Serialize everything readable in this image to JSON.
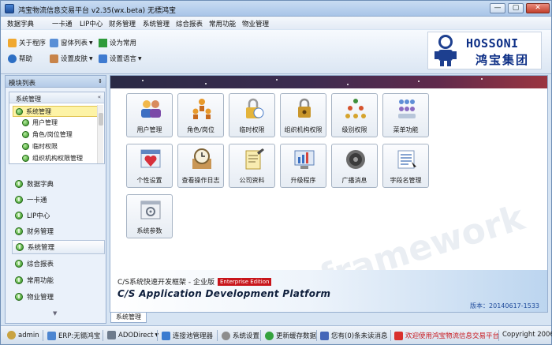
{
  "window": {
    "title": "鸿宝物流信息交易平台 v2.35(wx.beta) 无標鸿宝",
    "min": "—",
    "max": "▢",
    "close": "✕"
  },
  "menu": [
    "数据字典",
    "一卡通",
    "LIP中心",
    "财务管理",
    "系统管理",
    "综合报表",
    "常用功能",
    "物业管理"
  ],
  "toolbar": {
    "about": "关于程序",
    "window_list": "窗体列表",
    "set_common": "设为常用",
    "help": "帮助",
    "skin": "设置皮肤",
    "language": "设置语言"
  },
  "logo": {
    "en": "HOSSONI",
    "cn": "鸿宝集团"
  },
  "left": {
    "title": "模块列表",
    "pin": "⇕",
    "sub_title": "系统管理",
    "sub_selected": "系统管理",
    "sub_items": [
      "用户管理",
      "角色/岗位管理",
      "临时权限",
      "组织机构权限管理"
    ],
    "nav": [
      "数据字典",
      "一卡通",
      "LIP中心",
      "财务管理",
      "系统管理",
      "综合报表",
      "常用功能",
      "物业管理"
    ]
  },
  "tiles": [
    "用户管理",
    "角色/岗位",
    "临时权限",
    "组织机构权限",
    "级别权限",
    "菜单功能",
    "个性设置",
    "查看操作日志",
    "公司资料",
    "升级程序",
    "广播消息",
    "字段名管理",
    "系统参数"
  ],
  "footer": {
    "cn": "C/S系统快速开发框架 - 企业版",
    "badge": "Enterprise Edition",
    "en": "C/S Application Development Platform",
    "version": "版本：20140617-1533"
  },
  "tab": "系统管理",
  "status": {
    "user": "admin",
    "erp": "ERP:无锡鸿宝",
    "ado": "ADODirect",
    "pool": "连接池管理器",
    "sys": "系统设置",
    "cache": "更新缓存数据",
    "msg": "您有(0)条未读消息",
    "welcome": "欢迎使用鸿宝物流信息交易平台",
    "copy": "Copyright 2006"
  },
  "watermark": "csframework",
  "colors": {
    "accent": "#1f4b9b",
    "badge": "#c8151b",
    "selected": "#fdf3a6"
  }
}
